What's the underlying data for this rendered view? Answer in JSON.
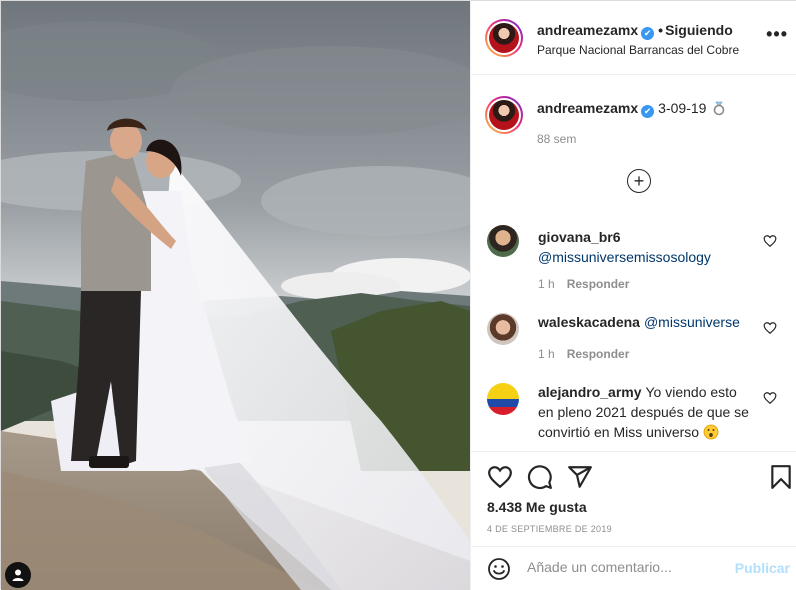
{
  "header": {
    "username": "andreamezamx",
    "verified_mark": "✔",
    "separator": "•",
    "follow_status": "Siguiendo",
    "location": "Parque Nacional Barrancas del Cobre",
    "more_label": "•••"
  },
  "caption": {
    "username": "andreamezamx",
    "verified_mark": "✔",
    "text": "3-09-19",
    "emoji": "ring-icon",
    "time": "88 sem"
  },
  "load_more_label": "+",
  "comments": [
    {
      "username": "giovana_br6",
      "text": "",
      "mention": "@missuniversemissosology",
      "time": "1 h",
      "reply_label": "Responder"
    },
    {
      "username": "waleskacadena",
      "text": "",
      "mention": "@missuniverse",
      "time": "1 h",
      "reply_label": "Responder"
    },
    {
      "username": "alejandro_army",
      "text": "Yo viendo esto en pleno 2021 después de que se convirtió en Miss universo",
      "mention": "",
      "emoji": "astonished-face-icon",
      "time": "",
      "reply_label": ""
    }
  ],
  "likes": "8.438 Me gusta",
  "date": "4 DE SEPTIEMBRE DE 2019",
  "comment_box": {
    "placeholder": "Añade un comentario...",
    "publish_label": "Publicar"
  },
  "colors": {
    "verified": "#3897f0",
    "mention": "#00376b",
    "publish_disabled": "#b2dffc",
    "muted": "#8e8e8e"
  }
}
